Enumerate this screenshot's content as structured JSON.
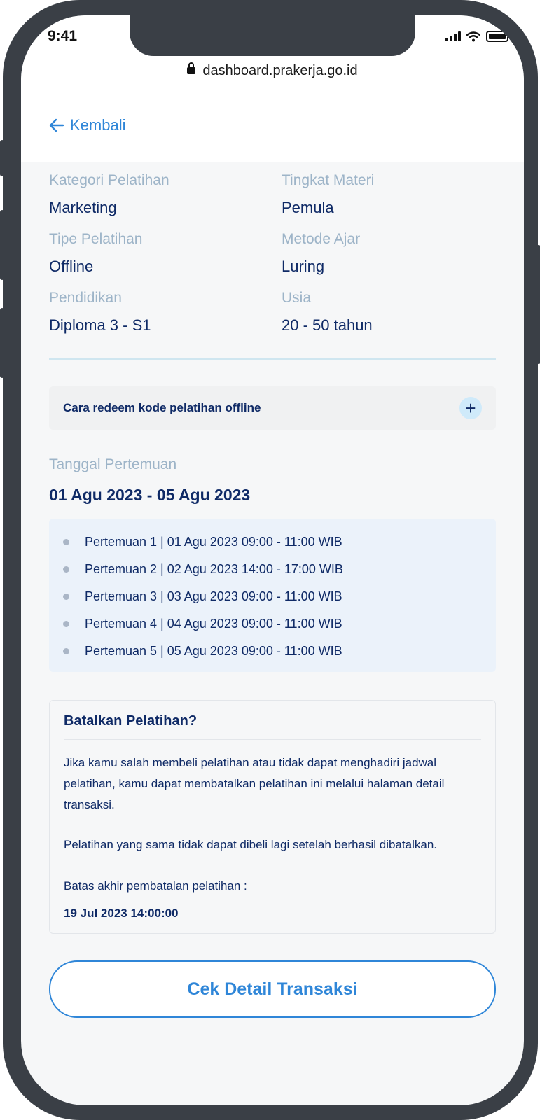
{
  "status_bar": {
    "time": "9:41"
  },
  "browser": {
    "url": "dashboard.prakerja.go.id"
  },
  "nav": {
    "back_label": "Kembali"
  },
  "details": [
    {
      "label": "Kategori Pelatihan",
      "value": "Marketing"
    },
    {
      "label": "Tingkat Materi",
      "value": "Pemula"
    },
    {
      "label": "Tipe Pelatihan",
      "value": "Offline"
    },
    {
      "label": "Metode Ajar",
      "value": "Luring"
    },
    {
      "label": "Pendidikan",
      "value": "Diploma 3 - S1"
    },
    {
      "label": "Usia",
      "value": "20 - 50 tahun"
    }
  ],
  "accordion": {
    "title": "Cara redeem kode pelatihan offline",
    "icon": "plus-icon"
  },
  "schedule": {
    "label": "Tanggal Pertemuan",
    "range": "01 Agu 2023 - 05 Agu 2023",
    "meetings": [
      "Pertemuan 1 | 01 Agu 2023 09:00 - 11:00 WIB",
      "Pertemuan 2 | 02 Agu 2023 14:00 - 17:00 WIB",
      "Pertemuan 3 | 03 Agu 2023 09:00 - 11:00 WIB",
      "Pertemuan 4 | 04 Agu 2023 09:00 - 11:00 WIB",
      "Pertemuan 5 | 05 Agu 2023 09:00 - 11:00 WIB"
    ]
  },
  "cancel": {
    "title": "Batalkan Pelatihan?",
    "paragraph_1": "Jika kamu salah membeli pelatihan atau tidak dapat menghadiri jadwal pelatihan, kamu dapat membatalkan pelatihan ini melalui halaman detail transaksi.",
    "paragraph_2": "Pelatihan yang sama tidak dapat dibeli lagi setelah berhasil dibatalkan.",
    "deadline_label": "Batas akhir pembatalan pelatihan :",
    "deadline_value": "19 Jul 2023 14:00:00"
  },
  "cta": {
    "label": "Cek Detail Transaksi"
  },
  "colors": {
    "primary": "#2f86d8",
    "navy": "#0f2a66",
    "muted": "#9db4c8"
  }
}
